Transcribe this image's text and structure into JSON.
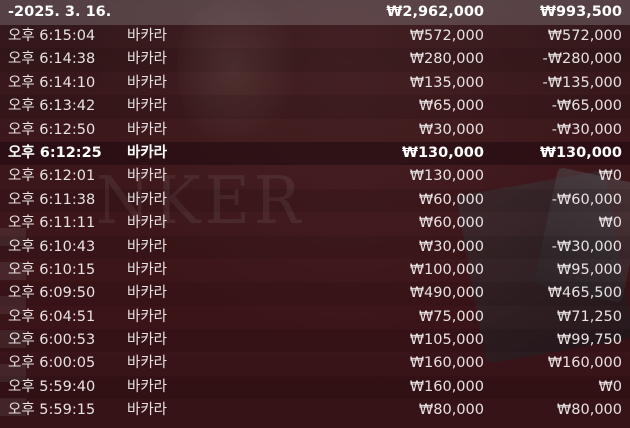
{
  "summary": {
    "date": "-2025. 3. 16.",
    "total_bet": "₩2,962,000",
    "total_result": "₩993,500"
  },
  "rows": [
    {
      "time": "오후 6:15:04",
      "game": "바카라",
      "bet": "₩572,000",
      "result": "₩572,000"
    },
    {
      "time": "오후 6:14:38",
      "game": "바카라",
      "bet": "₩280,000",
      "result": "-₩280,000"
    },
    {
      "time": "오후 6:14:10",
      "game": "바카라",
      "bet": "₩135,000",
      "result": "-₩135,000"
    },
    {
      "time": "오후 6:13:42",
      "game": "바카라",
      "bet": "₩65,000",
      "result": "-₩65,000"
    },
    {
      "time": "오후 6:12:50",
      "game": "바카라",
      "bet": "₩30,000",
      "result": "-₩30,000"
    },
    {
      "time": "오후 6:12:25",
      "game": "바카라",
      "bet": "₩130,000",
      "result": "₩130,000"
    },
    {
      "time": "오후 6:12:01",
      "game": "바카라",
      "bet": "₩130,000",
      "result": "₩0"
    },
    {
      "time": "오후 6:11:38",
      "game": "바카라",
      "bet": "₩60,000",
      "result": "-₩60,000"
    },
    {
      "time": "오후 6:11:11",
      "game": "바카라",
      "bet": "₩60,000",
      "result": "₩0"
    },
    {
      "time": "오후 6:10:43",
      "game": "바카라",
      "bet": "₩30,000",
      "result": "-₩30,000"
    },
    {
      "time": "오후 6:10:15",
      "game": "바카라",
      "bet": "₩100,000",
      "result": "₩95,000"
    },
    {
      "time": "오후 6:09:50",
      "game": "바카라",
      "bet": "₩490,000",
      "result": "₩465,500"
    },
    {
      "time": "오후 6:04:51",
      "game": "바카라",
      "bet": "₩75,000",
      "result": "₩71,250"
    },
    {
      "time": "오후 6:00:53",
      "game": "바카라",
      "bet": "₩105,000",
      "result": "₩99,750"
    },
    {
      "time": "오후 6:00:05",
      "game": "바카라",
      "bet": "₩160,000",
      "result": "₩160,000"
    },
    {
      "time": "오후 5:59:40",
      "game": "바카라",
      "bet": "₩160,000",
      "result": "₩0"
    },
    {
      "time": "오후 5:59:15",
      "game": "바카라",
      "bet": "₩80,000",
      "result": "₩80,000"
    }
  ],
  "background_text": "NKER",
  "colors": {
    "background": "#5a1d22",
    "text": "#e8e2e2",
    "header_bg": "#7a6a6e",
    "highlight_bg": "#2a0f12"
  }
}
